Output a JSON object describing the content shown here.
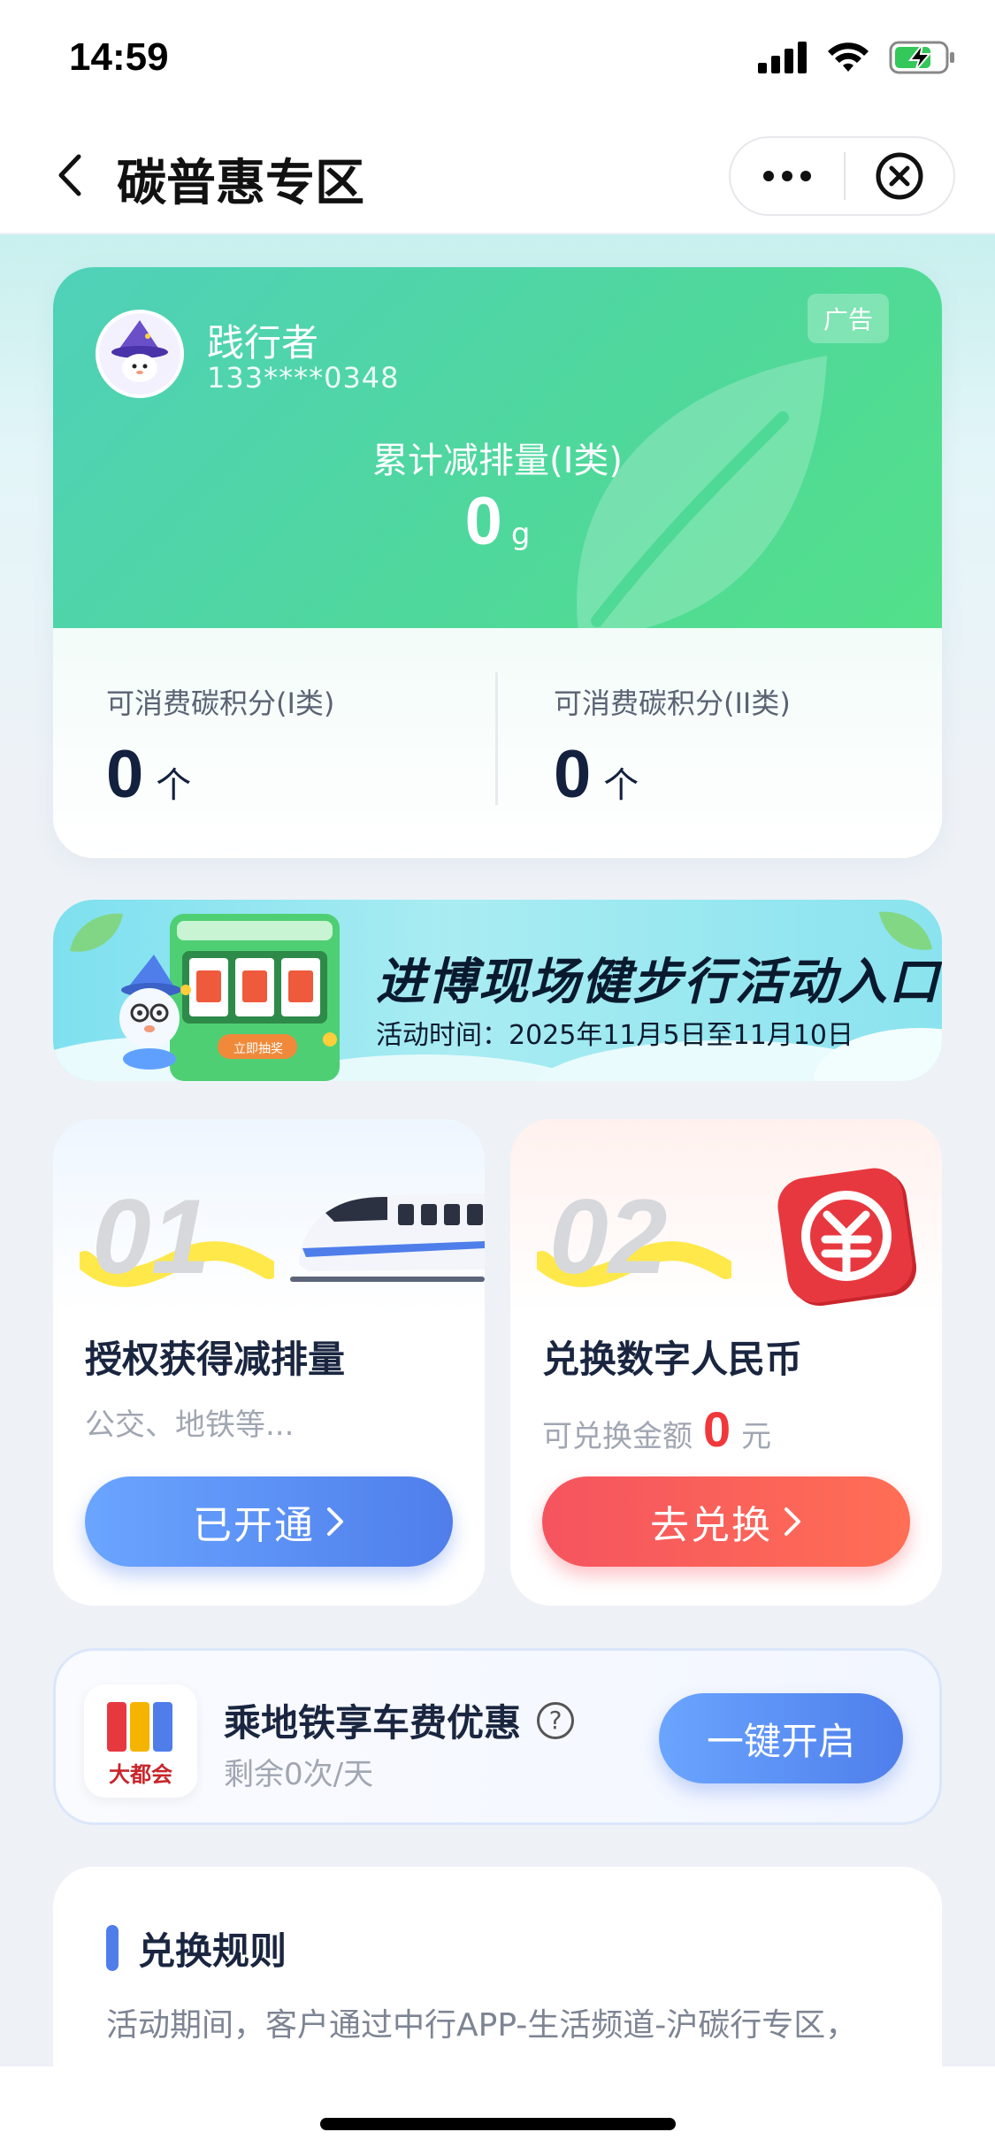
{
  "status_bar": {
    "time": "14:59"
  },
  "nav": {
    "title": "碳普惠专区"
  },
  "user_card": {
    "name": "践行者",
    "phone": "133****0348",
    "ad_tag": "广告",
    "emission_label": "累计减排量(I类)",
    "emission_value": "0",
    "emission_unit": "g",
    "points": [
      {
        "label": "可消费碳积分(I类)",
        "value": "0",
        "unit": "个"
      },
      {
        "label": "可消费碳积分(II类)",
        "value": "0",
        "unit": "个"
      }
    ]
  },
  "banner": {
    "title": "进博现场健步行活动入口",
    "subtitle": "活动时间：2025年11月5日至11月10日",
    "machine_button": "立即抽奖"
  },
  "features": [
    {
      "number": "01",
      "title": "授权获得减排量",
      "desc": "公交、地铁等...",
      "button": "已开通"
    },
    {
      "number": "02",
      "title": "兑换数字人民币",
      "desc_prefix": "可兑换金额",
      "amount": "0",
      "desc_suffix": "元",
      "button": "去兑换"
    }
  ],
  "metro": {
    "logo_text": "大都会",
    "title": "乘地铁享车费优惠",
    "help": "?",
    "sub": "剩余0次/天",
    "button": "一键开启"
  },
  "rules": {
    "title": "兑换规则",
    "text": "活动期间，客户通过中行APP-生活频道-沪碳行专区，"
  },
  "colors": {
    "card_green": "#4fd89a",
    "button_blue": "#4f7eeb",
    "button_red": "#f5545f",
    "amount_red": "#f0383a"
  }
}
